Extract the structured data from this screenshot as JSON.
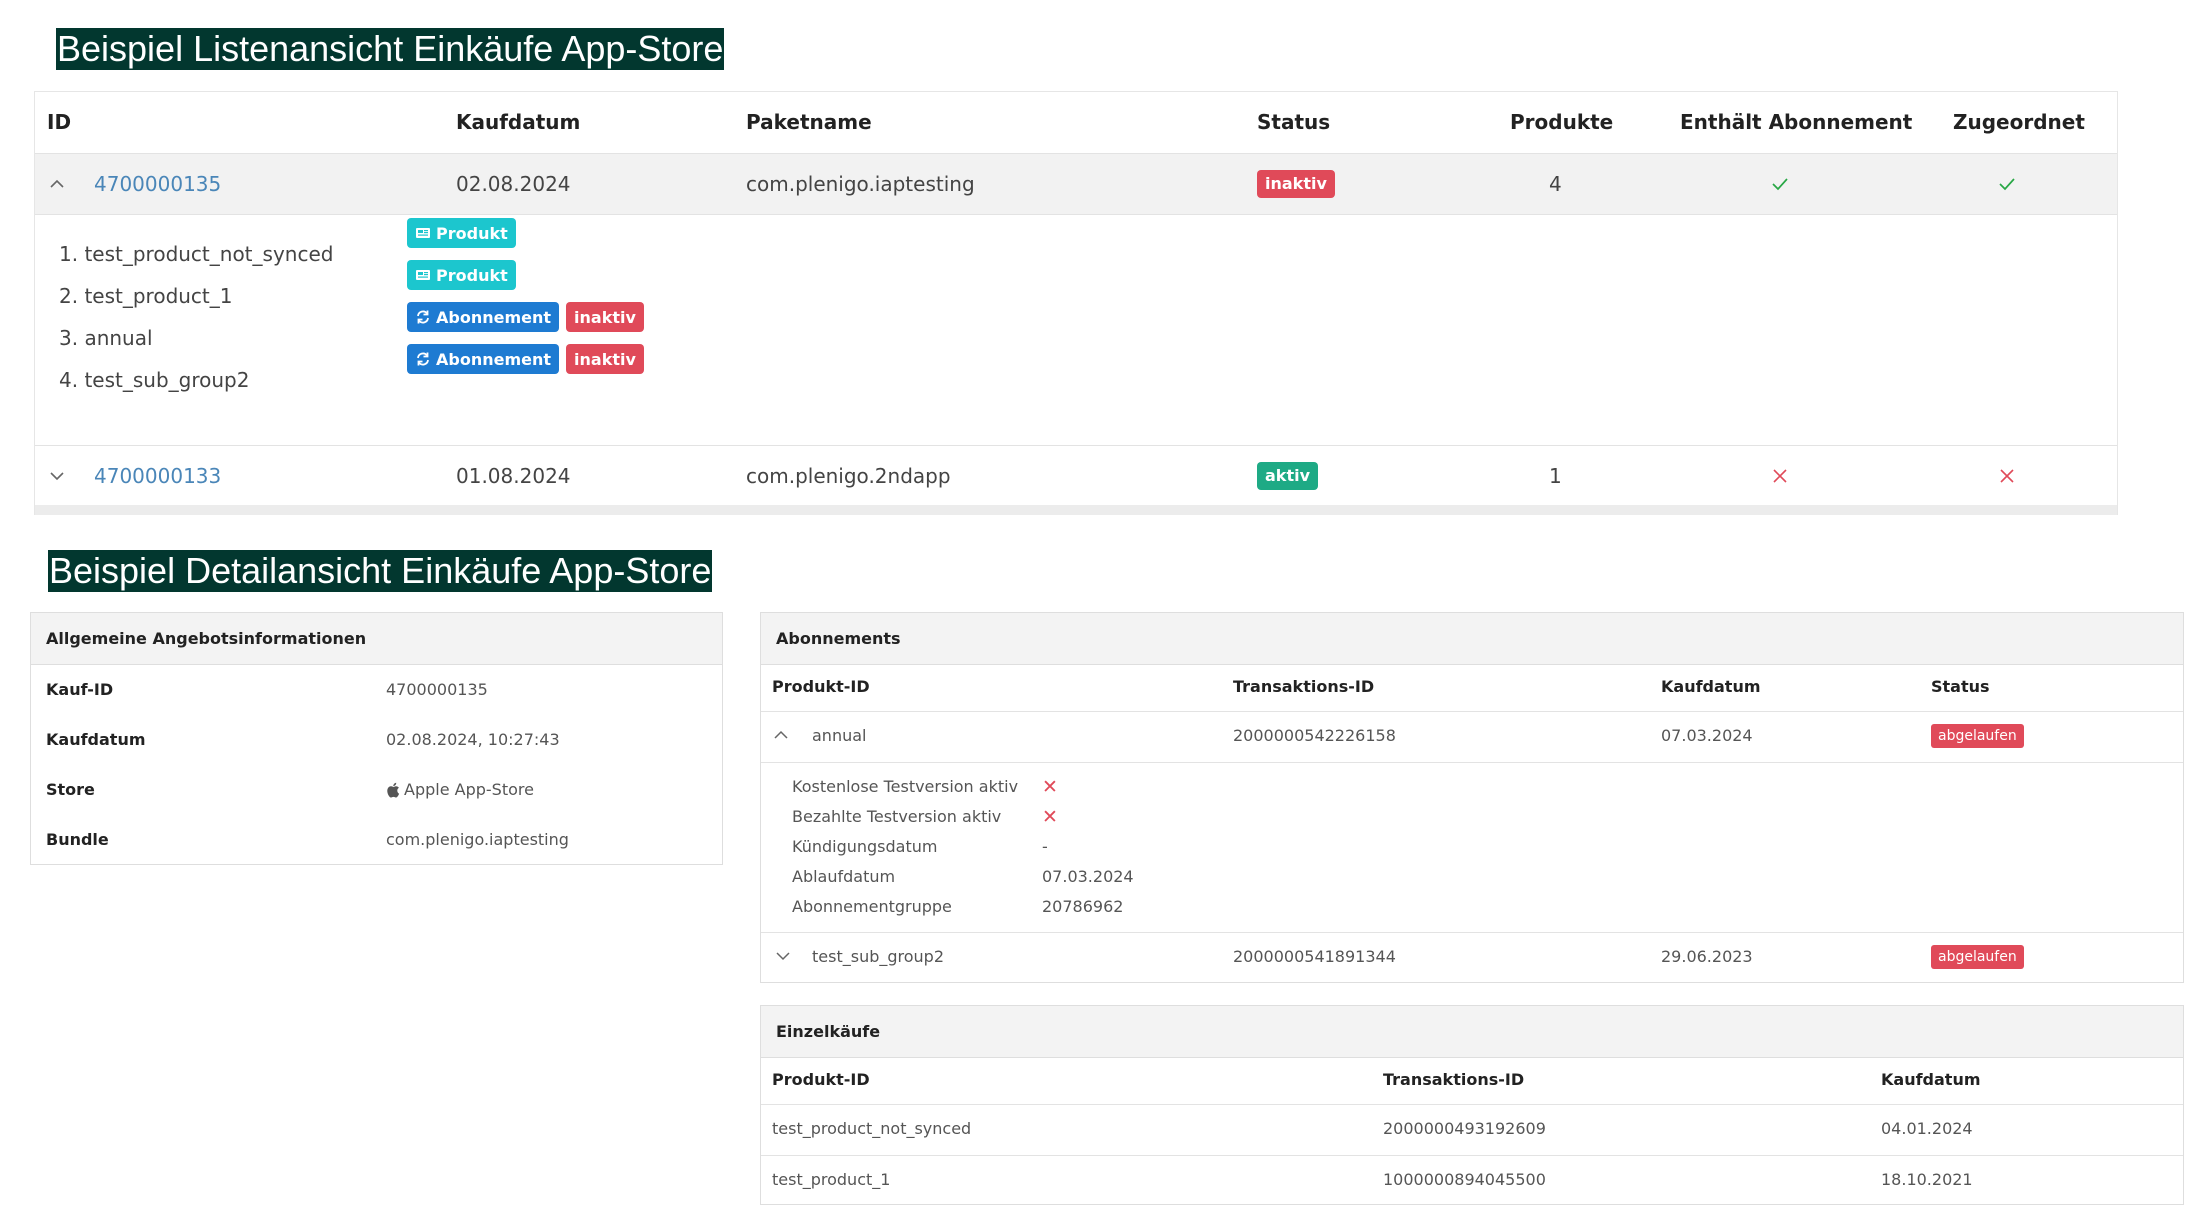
{
  "list_view": {
    "title": "Beispiel Listenansicht Einkäufe App-Store",
    "headers": [
      "ID",
      "Kaufdatum",
      "Paketname",
      "Status",
      "Produkte",
      "Enthält Abonnement",
      "Zugeordnet"
    ],
    "rows": [
      {
        "id": "4700000135",
        "date": "02.08.2024",
        "package": "com.plenigo.iaptesting",
        "status": "inaktiv",
        "products": "4",
        "has_subscription": true,
        "assigned": true,
        "expanded": true,
        "items": [
          {
            "label": "1. test_product_not_synced",
            "type": "Produkt",
            "status": ""
          },
          {
            "label": "2. test_product_1",
            "type": "Produkt",
            "status": ""
          },
          {
            "label": "3. annual",
            "type": "Abonnement",
            "status": "inaktiv"
          },
          {
            "label": "4. test_sub_group2",
            "type": "Abonnement",
            "status": "inaktiv"
          }
        ]
      },
      {
        "id": "4700000133",
        "date": "01.08.2024",
        "package": "com.plenigo.2ndapp",
        "status": "aktiv",
        "products": "1",
        "has_subscription": false,
        "assigned": false,
        "expanded": false
      }
    ]
  },
  "detail_view": {
    "title": "Beispiel Detailansicht Einkäufe App-Store",
    "general": {
      "heading": "Allgemeine Angebotsinformationen",
      "rows": [
        {
          "label": "Kauf-ID",
          "value": "4700000135"
        },
        {
          "label": "Kaufdatum",
          "value": "02.08.2024, 10:27:43"
        },
        {
          "label": "Store",
          "value": "Apple App-Store"
        },
        {
          "label": "Bundle",
          "value": "com.plenigo.iaptesting"
        }
      ]
    },
    "subscriptions": {
      "heading": "Abonnements",
      "headers": [
        "Produkt-ID",
        "Transaktions-ID",
        "Kaufdatum",
        "Status"
      ],
      "rows": [
        {
          "product_id": "annual",
          "transaction_id": "2000000542226158",
          "date": "07.03.2024",
          "status": "abgelaufen",
          "expanded": true,
          "details": [
            {
              "label": "Kostenlose Testversion aktiv",
              "value": "",
              "cross": true
            },
            {
              "label": "Bezahlte Testversion aktiv",
              "value": "",
              "cross": true
            },
            {
              "label": "Kündigungsdatum",
              "value": "-",
              "cross": false
            },
            {
              "label": "Ablaufdatum",
              "value": "07.03.2024",
              "cross": false
            },
            {
              "label": "Abonnementgruppe",
              "value": "20786962",
              "cross": false
            }
          ]
        },
        {
          "product_id": "test_sub_group2",
          "transaction_id": "2000000541891344",
          "date": "29.06.2023",
          "status": "abgelaufen",
          "expanded": false
        }
      ]
    },
    "single_purchases": {
      "heading": "Einzelkäufe",
      "headers": [
        "Produkt-ID",
        "Transaktions-ID",
        "Kaufdatum"
      ],
      "rows": [
        {
          "product_id": "test_product_not_synced",
          "transaction_id": "2000000493192609",
          "date": "04.01.2024"
        },
        {
          "product_id": "test_product_1",
          "transaction_id": "1000000894045500",
          "date": "18.10.2021"
        }
      ]
    }
  },
  "colors": {
    "banner_bg": "#02372f",
    "link": "#4a86b8",
    "danger": "#e04a59",
    "success": "#1eaa85",
    "check": "#28a745",
    "product_tag": "#1cc6ce",
    "subscription_tag": "#1e7bd2"
  },
  "icons": {
    "collapse": "chevron-up-icon",
    "expand": "chevron-down-icon",
    "yes": "checkmark-icon",
    "no": "cross-icon",
    "product": "newspaper-icon",
    "subscription": "refresh-icon",
    "store": "apple-icon"
  }
}
